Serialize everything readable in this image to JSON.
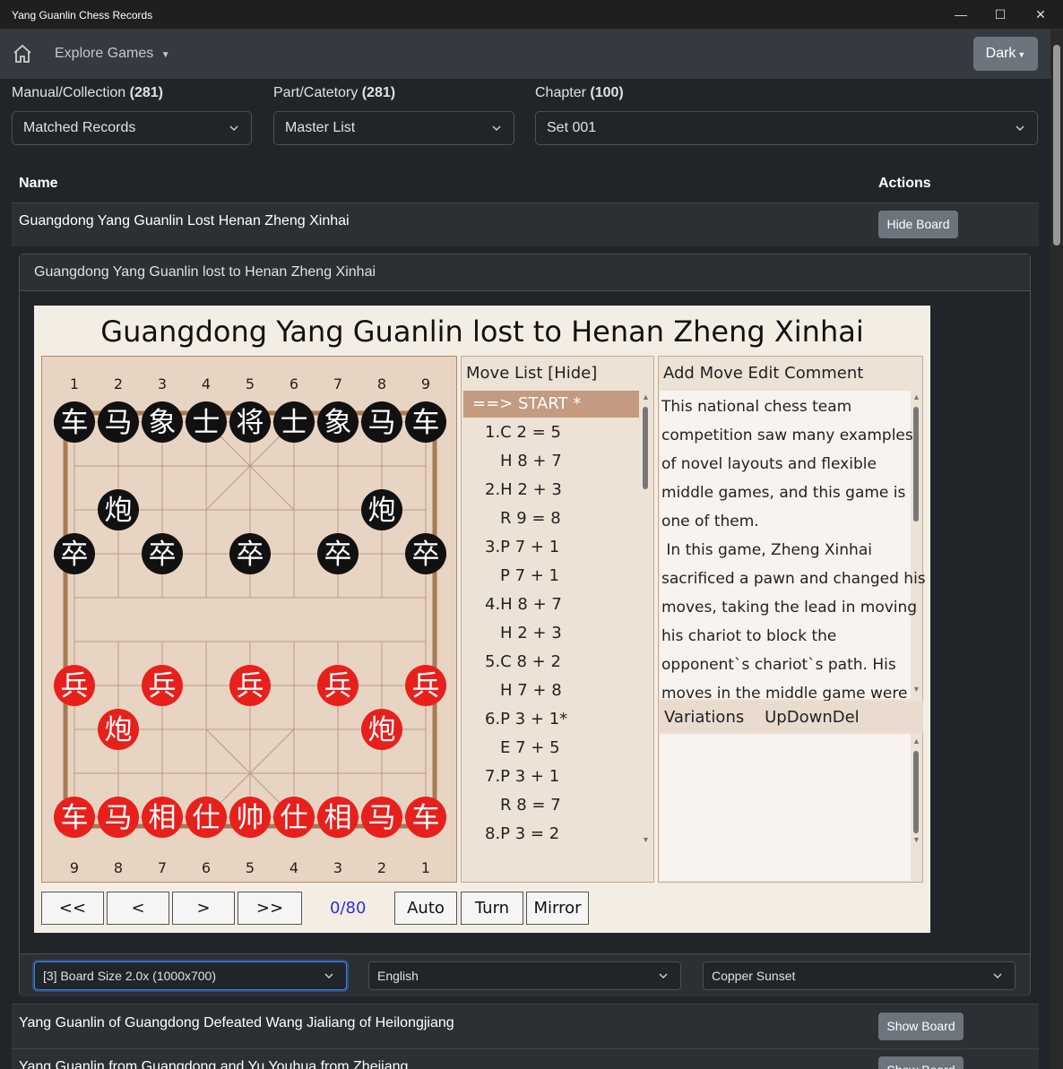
{
  "window": {
    "title": "Yang Guanlin Chess Records",
    "min": "—",
    "max": "☐",
    "close": "✕"
  },
  "nav": {
    "explore": "Explore Games",
    "theme": "Dark"
  },
  "filters": {
    "manual_label": "Manual/Collection",
    "manual_count": "(281)",
    "manual_value": "Matched Records",
    "part_label": "Part/Catetory",
    "part_count": "(281)",
    "part_value": "Master List",
    "chapter_label": "Chapter",
    "chapter_count": "(100)",
    "chapter_value": "Set 001"
  },
  "table": {
    "col_name": "Name",
    "col_actions": "Actions"
  },
  "rows": [
    {
      "name": "Guangdong Yang Guanlin Lost Henan Zheng Xinhai",
      "action": "Hide Board"
    },
    {
      "name": "Yang Guanlin of Guangdong Defeated Wang Jialiang of Heilongjiang",
      "action": "Show Board"
    },
    {
      "name": "Yang Guanlin from Guangdong and Yu Youhua from Zhejiang",
      "action": "Show Board"
    }
  ],
  "card": {
    "header": "Guangdong Yang Guanlin lost to Henan Zheng Xinhai"
  },
  "game": {
    "title": "Guangdong Yang Guanlin lost to Henan Zheng Xinhai",
    "top_files": [
      "1",
      "2",
      "3",
      "4",
      "5",
      "6",
      "7",
      "8",
      "9"
    ],
    "bottom_files": [
      "9",
      "8",
      "7",
      "6",
      "5",
      "4",
      "3",
      "2",
      "1"
    ],
    "black_back": [
      "车",
      "马",
      "象",
      "士",
      "将",
      "士",
      "象",
      "马",
      "车"
    ],
    "black_cannon": "炮",
    "black_pawn": "卒",
    "red_back": [
      "车",
      "马",
      "相",
      "仕",
      "帅",
      "仕",
      "相",
      "马",
      "车"
    ],
    "red_cannon": "炮",
    "red_pawn": "兵",
    "colors": {
      "black_piece": "#111111",
      "red_piece": "#e8201c",
      "board": "#e8d4c2",
      "highlight": "#c49a80"
    },
    "movelist_head": "Move List [Hide]",
    "moves": [
      "==> START *",
      "1.C 2 = 5",
      "H 8 + 7",
      "2.H 2 + 3",
      "R 9 = 8",
      "3.P 7 + 1",
      "P 7 + 1",
      "4.H 8 + 7",
      "H 2 + 3",
      "5.C 8 + 2",
      "H 7 + 8",
      "6.P 3 + 1*",
      "E 7 + 5",
      "7.P 3 + 1",
      "R 8 = 7",
      "8.P 3 = 2"
    ],
    "comment_head": "Add Move Edit Comment",
    "comment_lines": [
      "This national chess team",
      "competition saw many examples",
      "of novel layouts and flexible",
      "middle games, and this game is",
      "one of them.",
      " In this game, Zheng Xinhai",
      "sacrificed a pawn and changed his",
      "moves, taking the lead in moving",
      "his chariot to block the",
      "opponent`s chariot`s path. His",
      "moves in the middle game were"
    ],
    "variations_head": "Variations    UpDownDel",
    "controls": {
      "first": "<<",
      "prev": "<",
      "next": ">",
      "last": ">>",
      "counter": "0/80",
      "auto": "Auto",
      "turn": "Turn",
      "mirror": "Mirror"
    }
  },
  "footer": {
    "board_size": "[3] Board Size 2.0x (1000x700)",
    "language": "English",
    "theme": "Copper Sunset"
  }
}
